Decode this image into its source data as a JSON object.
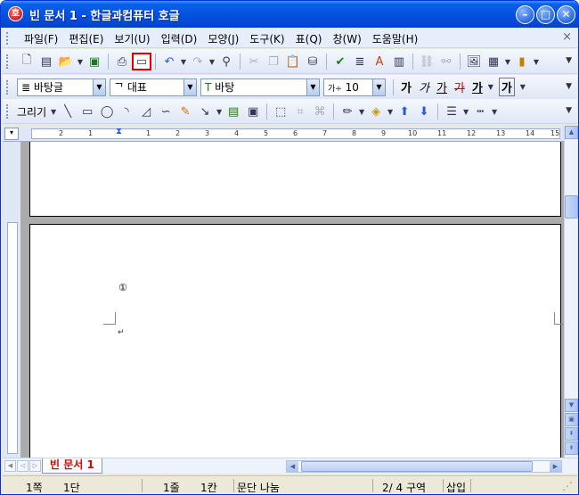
{
  "window": {
    "title": "빈 문서 1 - 한글과컴퓨터 호글",
    "app_icon_glyph": "호"
  },
  "menu": {
    "items": [
      "파일(F)",
      "편집(E)",
      "보기(U)",
      "입력(D)",
      "모양(J)",
      "도구(K)",
      "표(Q)",
      "창(W)",
      "도움말(H)"
    ],
    "close": "×"
  },
  "format_bar": {
    "style_value": "바탕글",
    "shape_value": "대표",
    "font_value": "바탕",
    "size_value": "10",
    "size_prefix": "가÷",
    "buttons": [
      "가",
      "가",
      "가",
      "가",
      "가",
      "가"
    ]
  },
  "draw_bar": {
    "label": "그리기"
  },
  "ruler": {
    "numbers": [
      "2",
      "1",
      "1",
      "2",
      "3",
      "4",
      "5",
      "6",
      "7",
      "8",
      "9",
      "10",
      "11",
      "12",
      "13",
      "14",
      "15"
    ]
  },
  "document": {
    "marker": "①",
    "para_mark": "↵"
  },
  "tabs": {
    "active": "빈 문서 1"
  },
  "status": {
    "page": "1쪽",
    "column": "1단",
    "line": "1줄",
    "char": "1칸",
    "para_split": "문단 나눔",
    "section": "2/  4 구역",
    "mode": "삽입"
  },
  "colors": {
    "titlebar": "#0453e0",
    "active_tab_text": "#e00000",
    "highlight_border": "#e00000"
  }
}
